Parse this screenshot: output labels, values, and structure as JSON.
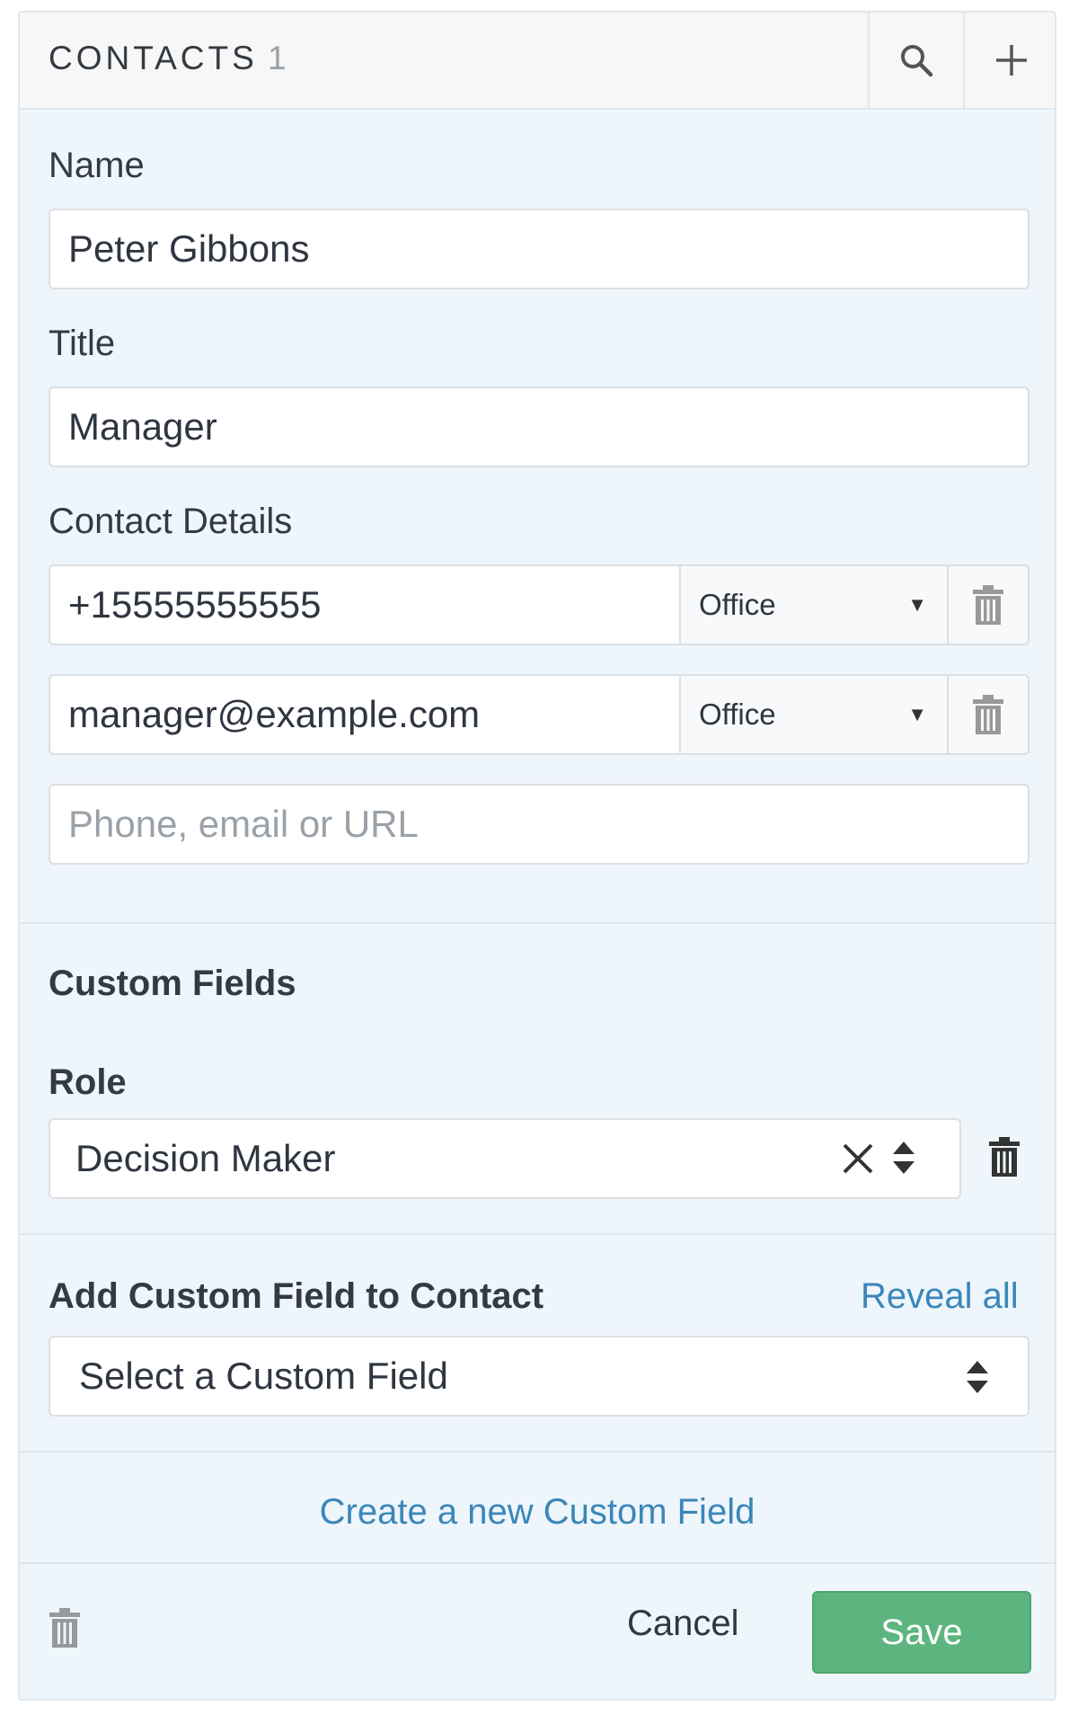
{
  "header": {
    "title": "CONTACTS",
    "count": "1"
  },
  "form": {
    "name_label": "Name",
    "name_value": "Peter Gibbons",
    "title_label": "Title",
    "title_value": "Manager",
    "contact_details_label": "Contact Details",
    "contact_details": [
      {
        "value": "+15555555555",
        "type": "Office"
      },
      {
        "value": "manager@example.com",
        "type": "Office"
      }
    ],
    "new_detail_placeholder": "Phone, email or URL"
  },
  "custom_fields": {
    "section_title": "Custom Fields",
    "role_label": "Role",
    "role_value": "Decision Maker"
  },
  "add_custom_field": {
    "title": "Add Custom Field to Contact",
    "reveal_all": "Reveal all",
    "select_placeholder": "Select a Custom Field",
    "create_link": "Create a new Custom Field"
  },
  "footer": {
    "cancel": "Cancel",
    "save": "Save"
  },
  "colors": {
    "save": "#5cb57e",
    "link": "#3a87b8",
    "panel_bg": "#eef5fb"
  },
  "icons": [
    "search-icon",
    "plus-icon",
    "trash-icon",
    "clear-icon",
    "sort-icon",
    "dropdown-arrow-icon"
  ]
}
